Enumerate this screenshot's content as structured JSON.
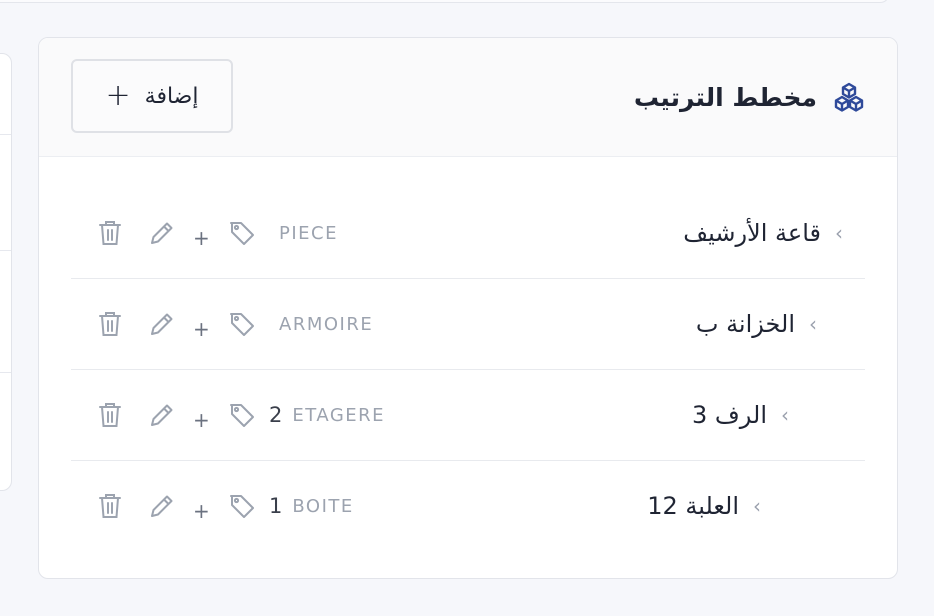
{
  "header": {
    "title": "مخطط الترتيب",
    "add_label": "إضافة"
  },
  "rows": [
    {
      "name": "قاعة الأرشيف",
      "number": "",
      "type": "PIECE"
    },
    {
      "name": "الخزانة ب",
      "number": "",
      "type": "ARMOIRE"
    },
    {
      "name": "الرف 3",
      "number": "2",
      "type": "ETAGERE"
    },
    {
      "name": "العلبة 12",
      "number": "1",
      "type": "BOITE"
    }
  ],
  "icons": {
    "title": "cubes-icon",
    "expand": "chevron-left-icon",
    "tag": "tag-icon",
    "add_child": "plus-icon",
    "edit": "pencil-icon",
    "delete": "trash-icon"
  },
  "colors": {
    "accent": "#2f4a9a",
    "muted_text": "#9ca3af"
  }
}
